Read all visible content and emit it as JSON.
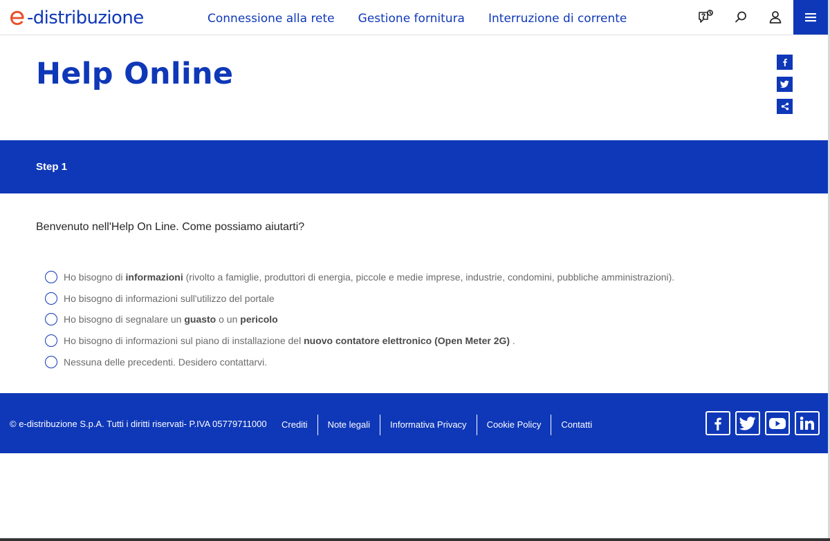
{
  "header": {
    "logo_text": "-distribuzione",
    "nav": [
      {
        "label": "Connessione alla rete"
      },
      {
        "label": "Gestione fornitura"
      },
      {
        "label": "Interruzione di corrente"
      }
    ],
    "icons": [
      "help-chat-icon",
      "search-icon",
      "user-icon",
      "hamburger-menu-icon"
    ]
  },
  "page": {
    "title": "Help Online",
    "share_icons": [
      "facebook-icon",
      "twitter-icon",
      "share-icon"
    ]
  },
  "step": {
    "label": "Step 1"
  },
  "form": {
    "question": "Benvenuto nell'Help On Line. Come possiamo aiutarti?",
    "options": [
      {
        "parts": [
          "Ho bisogno di ",
          "informazioni",
          " (rivolto a famiglie, produttori di energia, piccole e medie imprese, industrie, condomini, pubbliche amministrazioni)."
        ]
      },
      {
        "parts": [
          "Ho bisogno di informazioni sull'utilizzo del portale"
        ]
      },
      {
        "parts": [
          "Ho bisogno di segnalare un ",
          "guasto",
          " o un ",
          "pericolo"
        ]
      },
      {
        "parts": [
          "Ho bisogno di informazioni sul piano di installazione del ",
          "nuovo contatore elettronico (Open Meter 2G)",
          " ."
        ]
      },
      {
        "parts": [
          "Nessuna delle precedenti. Desidero contattarvi."
        ]
      }
    ]
  },
  "footer": {
    "copyright": "© e-distribuzione S.p.A. Tutti i diritti riservati- P.IVA 05779711000",
    "links": [
      {
        "label": "Crediti"
      },
      {
        "label": "Note legali"
      },
      {
        "label": "Informativa Privacy"
      },
      {
        "label": "Cookie Policy"
      },
      {
        "label": "Contatti"
      }
    ],
    "social": [
      "facebook-icon",
      "twitter-icon",
      "youtube-icon",
      "linkedin-icon"
    ]
  },
  "colors": {
    "brand_blue": "#0f38b8",
    "logo_orange": "#e8512d",
    "text": "#262626",
    "option_text": "#6b6b6b"
  }
}
